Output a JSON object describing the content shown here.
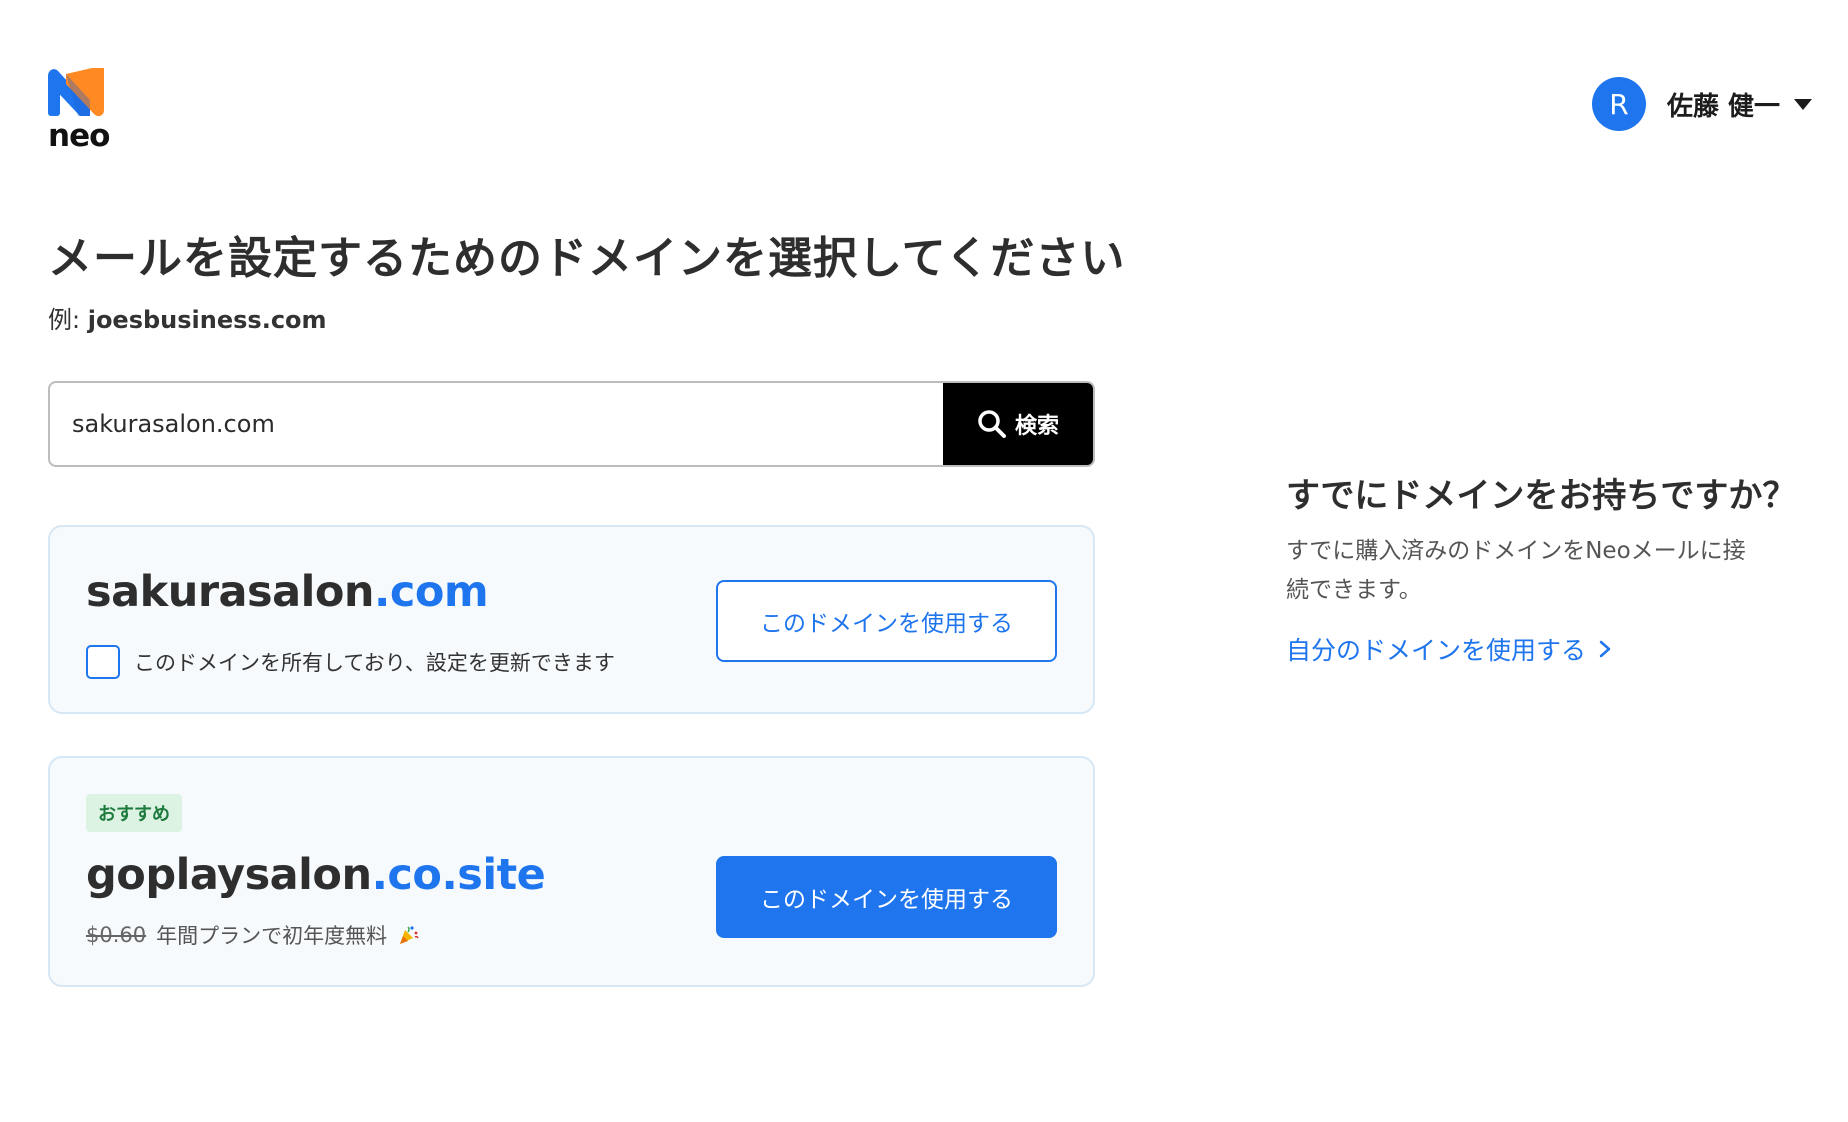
{
  "brand": {
    "logo_text": "neo",
    "colors": {
      "blue": "#1f75ee",
      "orange": "#ff8a24"
    }
  },
  "user": {
    "avatar_initial": "R",
    "name": "佐藤 健一"
  },
  "page": {
    "title": "メールを設定するためのドメインを選択してください",
    "example_prefix": "例: ",
    "example_domain": "joesbusiness.com"
  },
  "search": {
    "value": "sakurasalon.com",
    "button_label": "検索"
  },
  "results": [
    {
      "domain_name": "sakurasalon",
      "domain_tld": ".com",
      "own_checkbox_label": "このドメインを所有しており、設定を更新できます",
      "button_label": "このドメインを使用する"
    },
    {
      "badge": "おすすめ",
      "domain_name": "goplaysalon",
      "domain_tld": ".co.site",
      "old_price": "$0.60",
      "price_note": "年間プランで初年度無料",
      "button_label": "このドメインを使用する"
    }
  ],
  "sidebar": {
    "title": "すでにドメインをお持ちですか？",
    "description": "すでに購入済みのドメインをNeoメールに接続できます。",
    "link_label": "自分のドメインを使用する"
  }
}
